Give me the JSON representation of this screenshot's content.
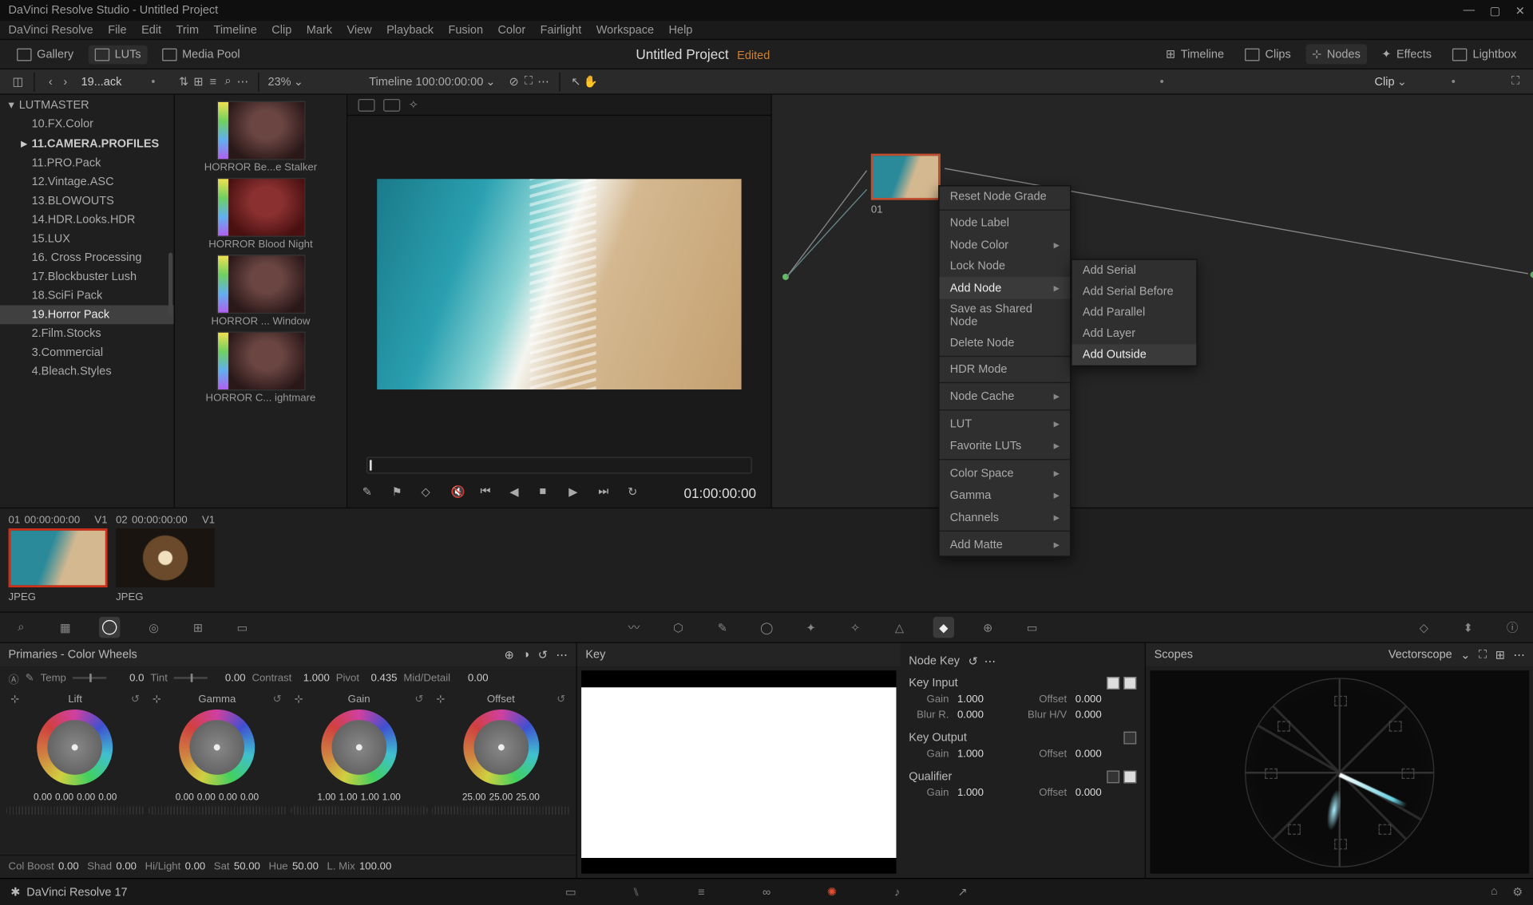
{
  "app": {
    "title": "DaVinci Resolve Studio - Untitled Project"
  },
  "menu": [
    "DaVinci Resolve",
    "File",
    "Edit",
    "Trim",
    "Timeline",
    "Clip",
    "Mark",
    "View",
    "Playback",
    "Fusion",
    "Color",
    "Fairlight",
    "Workspace",
    "Help"
  ],
  "uitoolbar": {
    "gallery": "Gallery",
    "luts": "LUTs",
    "mediapool": "Media Pool",
    "project": "Untitled Project",
    "edited": "Edited",
    "timeline": "Timeline",
    "clips": "Clips",
    "nodes": "Nodes",
    "effects": "Effects",
    "lightbox": "Lightbox"
  },
  "subbar_left": {
    "crumb": "19...ack",
    "zoom": "23%"
  },
  "subbar_mid": {
    "timeline": "Timeline 1",
    "tc": "00:00:00:00"
  },
  "subbar_right": {
    "clip": "Clip"
  },
  "folders": [
    {
      "lbl": "LUTMASTER",
      "root": true,
      "chev": "▾"
    },
    {
      "lbl": "10.FX.Color"
    },
    {
      "lbl": "11.CAMERA.PROFILES",
      "bold": true,
      "chev": "▸"
    },
    {
      "lbl": "11.PRO.Pack"
    },
    {
      "lbl": "12.Vintage.ASC"
    },
    {
      "lbl": "13.BLOWOUTS"
    },
    {
      "lbl": "14.HDR.Looks.HDR"
    },
    {
      "lbl": "15.LUX"
    },
    {
      "lbl": "16. Cross Processing"
    },
    {
      "lbl": "17.Blockbuster Lush"
    },
    {
      "lbl": "18.SciFi Pack"
    },
    {
      "lbl": "19.Horror Pack",
      "sel": true
    },
    {
      "lbl": "2.Film.Stocks"
    },
    {
      "lbl": "3.Commercial"
    },
    {
      "lbl": "4.Bleach.Styles"
    }
  ],
  "luts": [
    {
      "lbl": "HORROR Be...e Stalker"
    },
    {
      "lbl": "HORROR Blood Night",
      "red": true
    },
    {
      "lbl": "HORROR ... Window"
    },
    {
      "lbl": "HORROR C... ightmare"
    }
  ],
  "transport_tc": "01:00:00:00",
  "node": {
    "label": "01"
  },
  "context_menu": [
    {
      "lbl": "Reset Node Grade"
    },
    {
      "hr": true
    },
    {
      "lbl": "Node Label"
    },
    {
      "lbl": "Node Color",
      "sub": true
    },
    {
      "lbl": "Lock Node"
    },
    {
      "lbl": "Add Node",
      "sub": true,
      "hi": true
    },
    {
      "lbl": "Save as Shared Node"
    },
    {
      "lbl": "Delete Node"
    },
    {
      "hr": true
    },
    {
      "lbl": "HDR Mode"
    },
    {
      "hr": true
    },
    {
      "lbl": "Node Cache",
      "sub": true
    },
    {
      "hr": true
    },
    {
      "lbl": "LUT",
      "sub": true
    },
    {
      "lbl": "Favorite LUTs",
      "sub": true
    },
    {
      "hr": true
    },
    {
      "lbl": "Color Space",
      "sub": true
    },
    {
      "lbl": "Gamma",
      "sub": true
    },
    {
      "lbl": "Channels",
      "sub": true
    },
    {
      "hr": true
    },
    {
      "lbl": "Add Matte",
      "sub": true
    }
  ],
  "submenu": [
    "Add Serial",
    "Add Serial Before",
    "Add Parallel",
    "Add Layer",
    "Add Outside"
  ],
  "submenu_hi": "Add Outside",
  "clips": [
    {
      "hdr": "01",
      "tc": "00:00:00:00",
      "v": "V1",
      "fmt": "JPEG",
      "sel": true,
      "cls": "beach"
    },
    {
      "hdr": "02",
      "tc": "00:00:00:00",
      "v": "V1",
      "fmt": "JPEG",
      "cls": "coffee"
    }
  ],
  "panels": {
    "primaries_title": "Primaries - Color Wheels",
    "key_title": "Key",
    "nodekey_title": "Node Key",
    "scopes_title": "Scopes",
    "vectorscope": "Vectorscope"
  },
  "adjust": {
    "temp_lbl": "Temp",
    "temp": "0.0",
    "tint_lbl": "Tint",
    "tint": "0.00",
    "contrast_lbl": "Contrast",
    "contrast": "1.000",
    "pivot_lbl": "Pivot",
    "pivot": "0.435",
    "md_lbl": "Mid/Detail",
    "md": "0.00"
  },
  "wheels": [
    {
      "name": "Lift",
      "vals": [
        "0.00",
        "0.00",
        "0.00",
        "0.00"
      ]
    },
    {
      "name": "Gamma",
      "vals": [
        "0.00",
        "0.00",
        "0.00",
        "0.00"
      ]
    },
    {
      "name": "Gain",
      "vals": [
        "1.00",
        "1.00",
        "1.00",
        "1.00"
      ]
    },
    {
      "name": "Offset",
      "vals": [
        "25.00",
        "25.00",
        "25.00"
      ]
    }
  ],
  "bottom_adj": [
    {
      "lbl": "Col Boost",
      "val": "0.00"
    },
    {
      "lbl": "Shad",
      "val": "0.00"
    },
    {
      "lbl": "Hi/Light",
      "val": "0.00"
    },
    {
      "lbl": "Sat",
      "val": "50.00"
    },
    {
      "lbl": "Hue",
      "val": "50.00"
    },
    {
      "lbl": "L. Mix",
      "val": "100.00"
    }
  ],
  "key": {
    "input": "Key Input",
    "output": "Key Output",
    "qualifier": "Qualifier",
    "gain": "Gain",
    "offset": "Offset",
    "blurr": "Blur R.",
    "blurhv": "Blur H/V",
    "v1000": "1.000",
    "v0000": "0.000"
  },
  "status": {
    "app": "DaVinci Resolve 17"
  }
}
